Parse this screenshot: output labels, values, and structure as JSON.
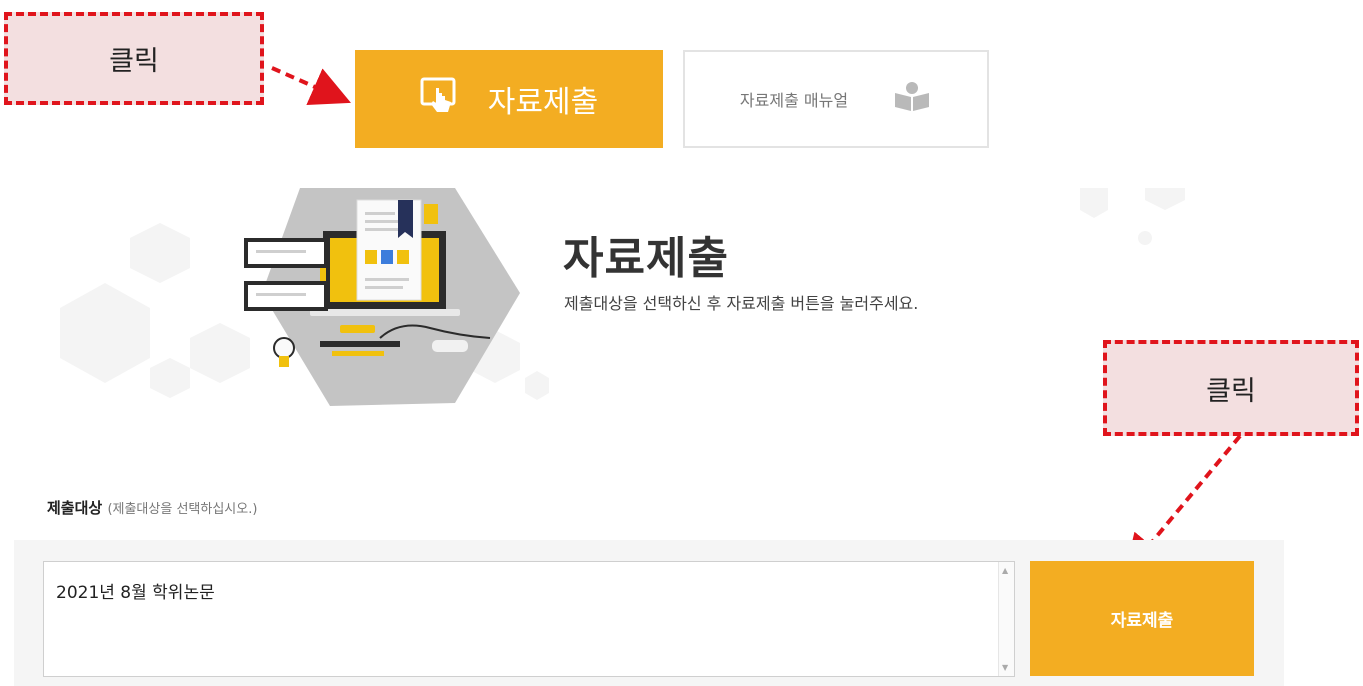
{
  "annotations": {
    "callout_top": "클릭",
    "callout_bottom": "클릭",
    "arrow_color": "#e0141c"
  },
  "tabs": {
    "submit_label": "자료제출",
    "submit_icon": "touch-screen-icon",
    "manual_label": "자료제출 매뉴얼",
    "manual_icon": "reading-person-icon",
    "accent_color": "#f3ad22"
  },
  "hero": {
    "title": "자료제출",
    "subtitle": "제출대상을 선택하신 후 자료제출 버튼을 눌러주세요."
  },
  "form": {
    "target_label": "제출대상",
    "target_hint": "(제출대상을 선택하십시오.)",
    "selected_option": "2021년 8월 학위논문",
    "submit_button": "자료제출"
  }
}
